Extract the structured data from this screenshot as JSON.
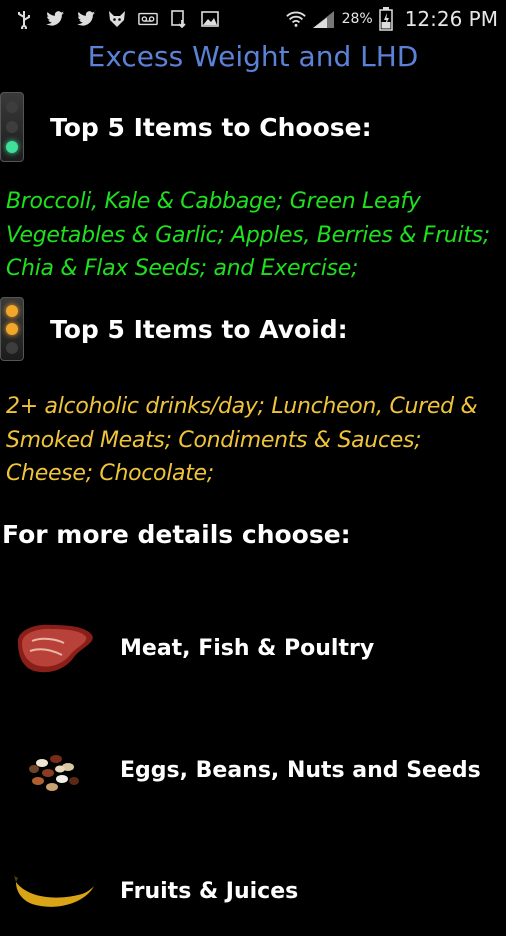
{
  "status_bar": {
    "icons": [
      "usb-icon",
      "twitter-icon",
      "twitter-icon",
      "fox-icon",
      "voicemail-icon",
      "download-icon",
      "image-icon"
    ],
    "battery_percent": "28%",
    "time": "12:26 PM"
  },
  "app": {
    "title": "Excess Weight and LHD"
  },
  "choose": {
    "heading": "Top 5 Items to Choose:",
    "lines": [
      "Broccoli, Kale & Cabbage; Green Leafy",
      "Vegetables & Garlic; Apples, Berries & Fruits;",
      "Chia & Flax Seeds;  and Exercise;"
    ],
    "color": "#1ee01e"
  },
  "avoid": {
    "heading": "Top 5 Items to Avoid:",
    "lines": [
      "2+ alcoholic drinks/day; Luncheon, Cured &",
      "Smoked Meats; Condiments & Sauces;",
      "Cheese; Chocolate;"
    ],
    "color": "#f0c43a"
  },
  "details": {
    "label": "For more details choose:",
    "items": [
      {
        "label": "Meat, Fish & Poultry",
        "icon": "steak-icon"
      },
      {
        "label": "Eggs, Beans, Nuts and Seeds",
        "icon": "beans-icon"
      },
      {
        "label": "Fruits & Juices",
        "icon": "banana-icon"
      }
    ]
  }
}
